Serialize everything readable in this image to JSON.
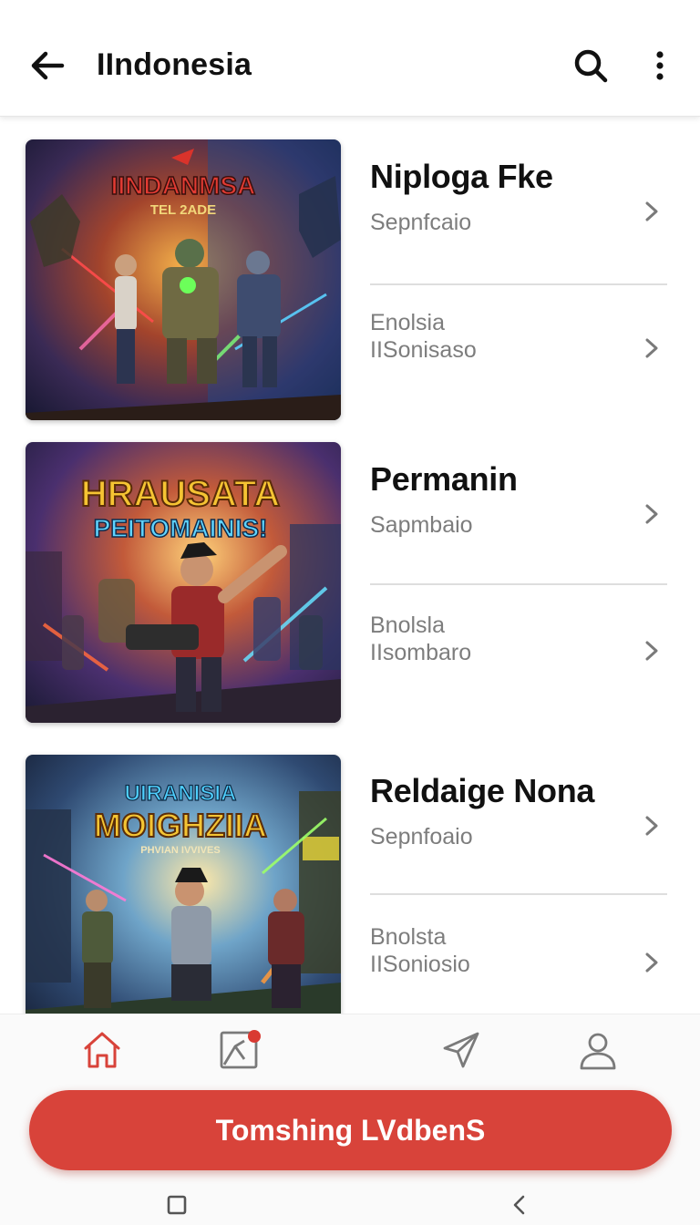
{
  "appbar": {
    "title": "IIndonesia",
    "back_icon": "arrow-left-icon",
    "search_icon": "search-icon",
    "more_icon": "more-vertical-icon"
  },
  "games": [
    {
      "art_title": "IINDANMSA",
      "art_subtitle": "TEL 2ADE",
      "rows": [
        {
          "name": "Niploga Fke",
          "sub": "Sepnfcaio"
        },
        {
          "line1": "Enolsia",
          "line2": "IISonisaso"
        }
      ]
    },
    {
      "art_title": "HRAUSATA",
      "art_subtitle": "PEITOMAINIS!",
      "rows": [
        {
          "name": "Permanin",
          "sub": "Sapmbaio"
        },
        {
          "line1": "Bnolsla",
          "line2": "IIsombaro"
        }
      ]
    },
    {
      "art_title": "UIRANISIA",
      "art_subtitle": "MOIGHZIIA",
      "art_tag": "PHVIAN IVVIVES",
      "rows": [
        {
          "name": "Reldaige Nona",
          "sub": "Sepnfoaio"
        },
        {
          "line1": "Bnolsta",
          "line2": "IISoniosio"
        }
      ]
    }
  ],
  "bottom_nav": {
    "items": [
      "home-icon",
      "gallery-icon",
      "send-icon",
      "profile-icon"
    ],
    "active": "home-icon"
  },
  "cta": {
    "label": "Tomshing LVdbenS"
  },
  "system_nav": [
    "square-icon",
    "back-chevron-icon"
  ],
  "colors": {
    "accent": "#d8433a",
    "text": "#111111",
    "muted": "#7d7d7d",
    "divider": "#dedede"
  }
}
